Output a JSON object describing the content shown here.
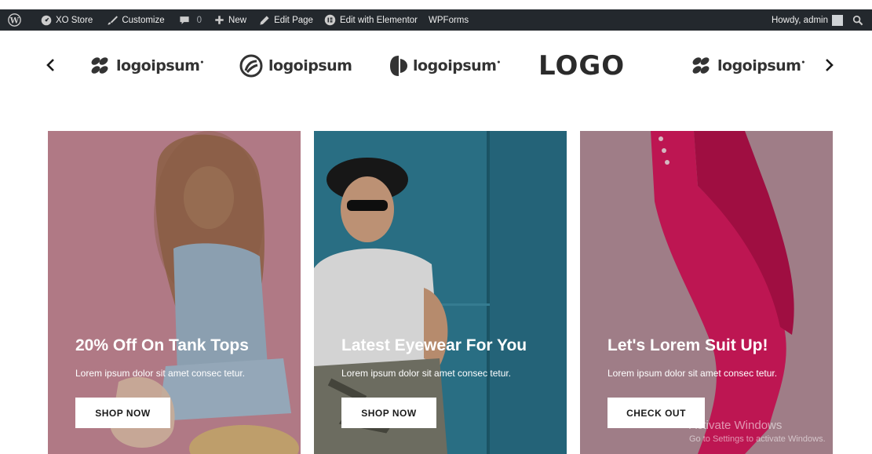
{
  "admin_bar": {
    "site_name": "XO Store",
    "customize": "Customize",
    "comments_count": "0",
    "new": "New",
    "edit_page": "Edit Page",
    "edit_elementor": "Edit with Elementor",
    "wpforms": "WPForms",
    "howdy": "Howdy, admin"
  },
  "logos": [
    {
      "text": "logoipsum",
      "icon": "bubbles-logo-icon"
    },
    {
      "text": "logoipsum",
      "icon": "circle-swirl-logo-icon"
    },
    {
      "text": "logoipsum",
      "icon": "half-circle-logo-icon"
    },
    {
      "text": "LOGO",
      "icon": "logo-wordmark"
    },
    {
      "text": "logoipsum",
      "icon": "bubbles-logo-icon"
    }
  ],
  "cards": [
    {
      "title": "20% Off On Tank Tops",
      "text": "Lorem ipsum dolor sit amet consec tetur.",
      "button": "SHOP NOW"
    },
    {
      "title": "Latest Eyewear For You",
      "text": "Lorem ipsum dolor sit amet consec tetur.",
      "button": "SHOP NOW"
    },
    {
      "title": "Let's Lorem Suit Up!",
      "text": "Lorem ipsum dolor sit amet consec tetur.",
      "button": "CHECK OUT"
    }
  ],
  "watermark": {
    "title": "Activate Windows",
    "subtitle": "Go to Settings to activate Windows."
  },
  "colors": {
    "admin_bar_bg": "#23282d",
    "card1_bg": "#c98a98",
    "card2_bg": "#2f7e96",
    "card3_bg": "#b58f9a",
    "button_bg": "#ffffff"
  }
}
